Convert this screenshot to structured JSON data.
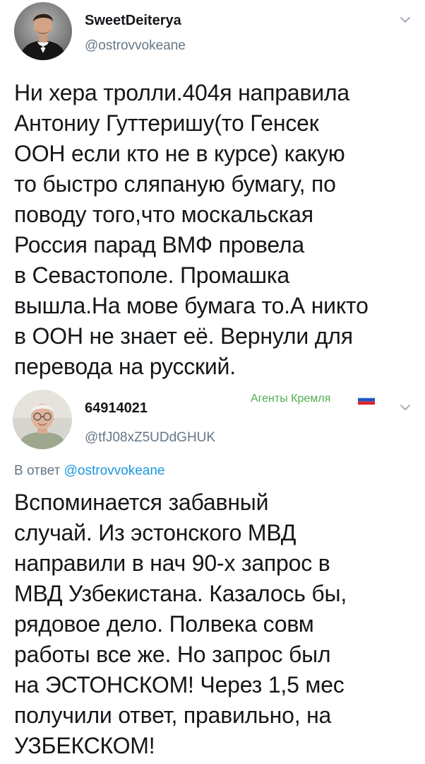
{
  "tweets": [
    {
      "display_name": "SweetDeiterya",
      "handle": "@ostrovvokeane",
      "lines": [
        "Ни хера тролли.404я направила",
        "Антониу Гуттеришу(то Генсек",
        "ООН если кто не в курсе) какую",
        "то быстро сляпаную бумагу, по",
        "поводу того,что москальская",
        "Россия парад ВМФ провела",
        "в Севастополе. Промашка",
        "вышла.На мове бумага то.А никто",
        "в ООН не знает её. Вернули для",
        "перевода на русский."
      ]
    },
    {
      "display_name": "64914021",
      "handle": "@tfJ08xZ5UDdGHUK",
      "label": "Агенты Кремля",
      "reply_prefix": "В ответ",
      "reply_mention": "@ostrovvokeane",
      "lines": [
        "Вспоминается забавный",
        "случай. Из эстонского МВД",
        "направили в нач 90-х запрос в",
        "МВД Узбекистана. Казалось бы,",
        "рядовое дело. Полвека совм",
        "работы все же. Но запрос был",
        "на ЭСТОНСКОМ! Через 1,5 мес",
        "получили ответ, правильно, на",
        "УЗБЕКСКОМ!"
      ]
    }
  ],
  "icons": {
    "chevron": "chevron-down-icon",
    "flag": "russian-flag-icon"
  },
  "colors": {
    "text": "#14171a",
    "secondary": "#657786",
    "link": "#1b95e0",
    "label": "#4fae4f"
  }
}
